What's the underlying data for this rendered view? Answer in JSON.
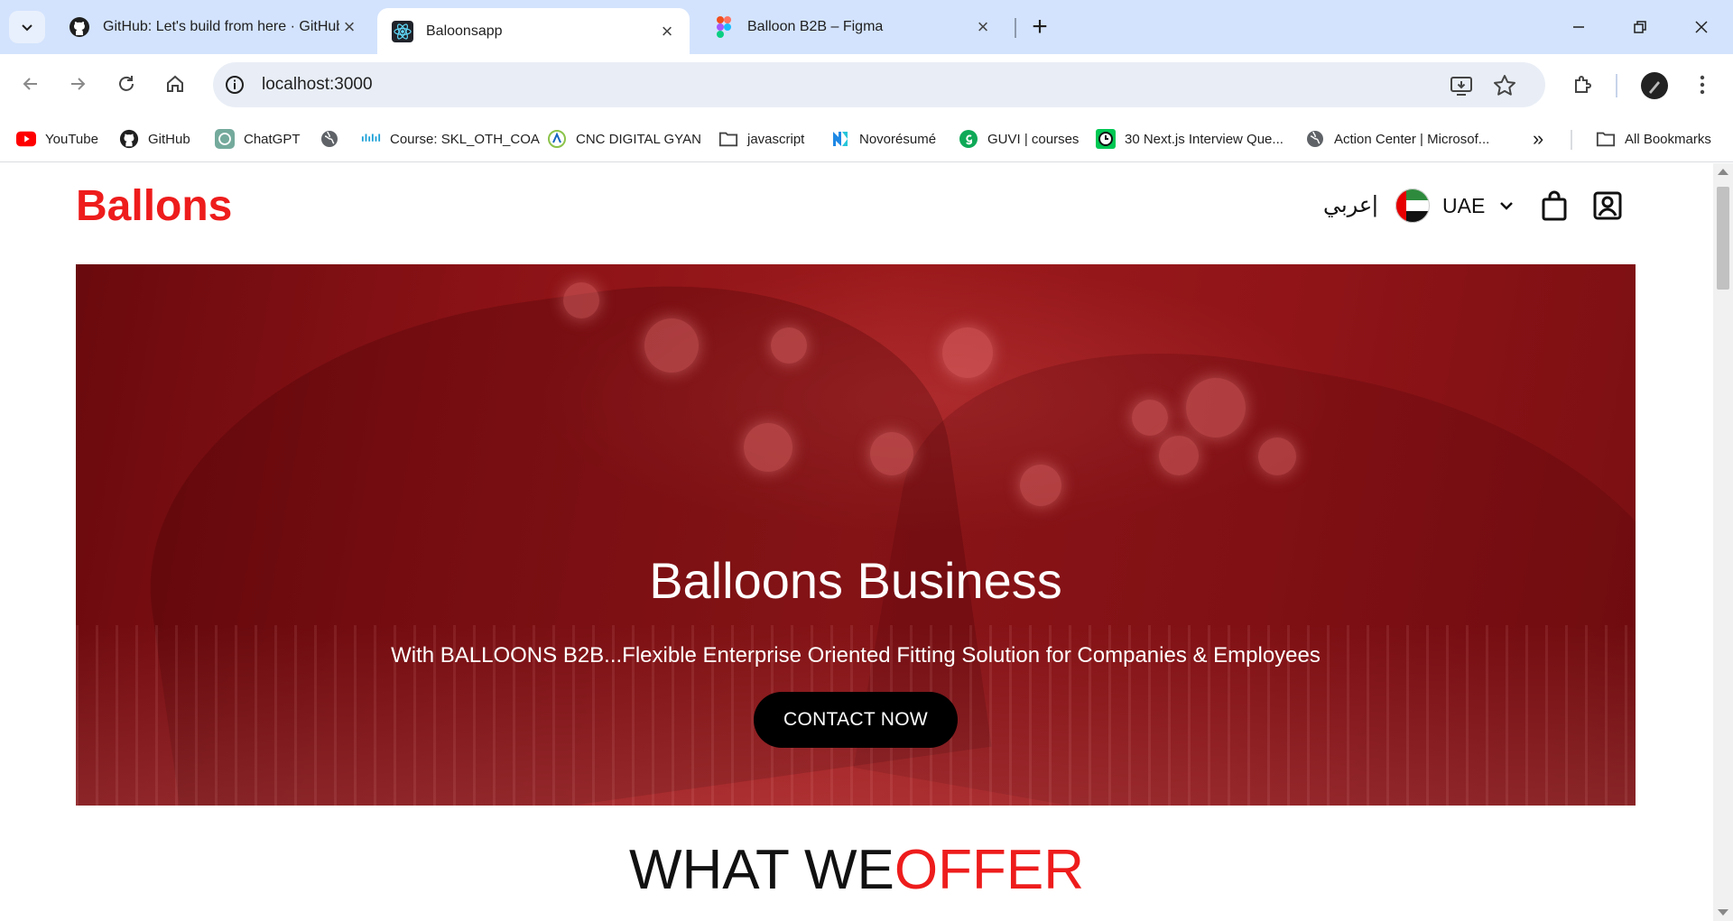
{
  "browser": {
    "tabs": [
      {
        "title": "GitHub: Let's build from here · GitHub",
        "icon": "github-icon",
        "active": false
      },
      {
        "title": "Baloonsapp",
        "icon": "react-icon",
        "active": true
      },
      {
        "title": "Balloon B2B – Figma",
        "icon": "figma-icon",
        "active": false
      }
    ],
    "url": "localhost:3000",
    "bookmarks": [
      {
        "label": "YouTube",
        "icon": "youtube-icon"
      },
      {
        "label": "GitHub",
        "icon": "github-icon"
      },
      {
        "label": "ChatGPT",
        "icon": "chatgpt-icon"
      },
      {
        "label": "",
        "icon": "globe-icon"
      },
      {
        "label": "Course: SKL_OTH_COA",
        "icon": "cisco-icon"
      },
      {
        "label": "CNC DIGITAL GYAN",
        "icon": "cnc-icon"
      },
      {
        "label": "javascript",
        "icon": "folder-icon"
      },
      {
        "label": "Novorésumé",
        "icon": "novoresume-icon"
      },
      {
        "label": "GUVI | courses",
        "icon": "guvi-icon"
      },
      {
        "label": "30 Next.js Interview Que...",
        "icon": "clock-icon"
      },
      {
        "label": "Action Center | Microsof...",
        "icon": "globe-icon"
      }
    ],
    "all_bookmarks": "All Bookmarks",
    "overflow": "»"
  },
  "site": {
    "logo": "Ballons",
    "lang": "عربي",
    "lang_sep": "|",
    "country": "UAE",
    "hero": {
      "title": "Balloons Business",
      "subtitle": "With BALLOONS B2B...Flexible Enterprise Oriented Fitting Solution for Companies & Employees",
      "cta": "CONTACT NOW"
    },
    "offer": {
      "part1": "WHAT WE",
      "part2": "OFFER"
    }
  },
  "colors": {
    "brand_red": "#ee1c1c",
    "hero_red": "#9c1a1c",
    "cta_bg": "#000000"
  }
}
